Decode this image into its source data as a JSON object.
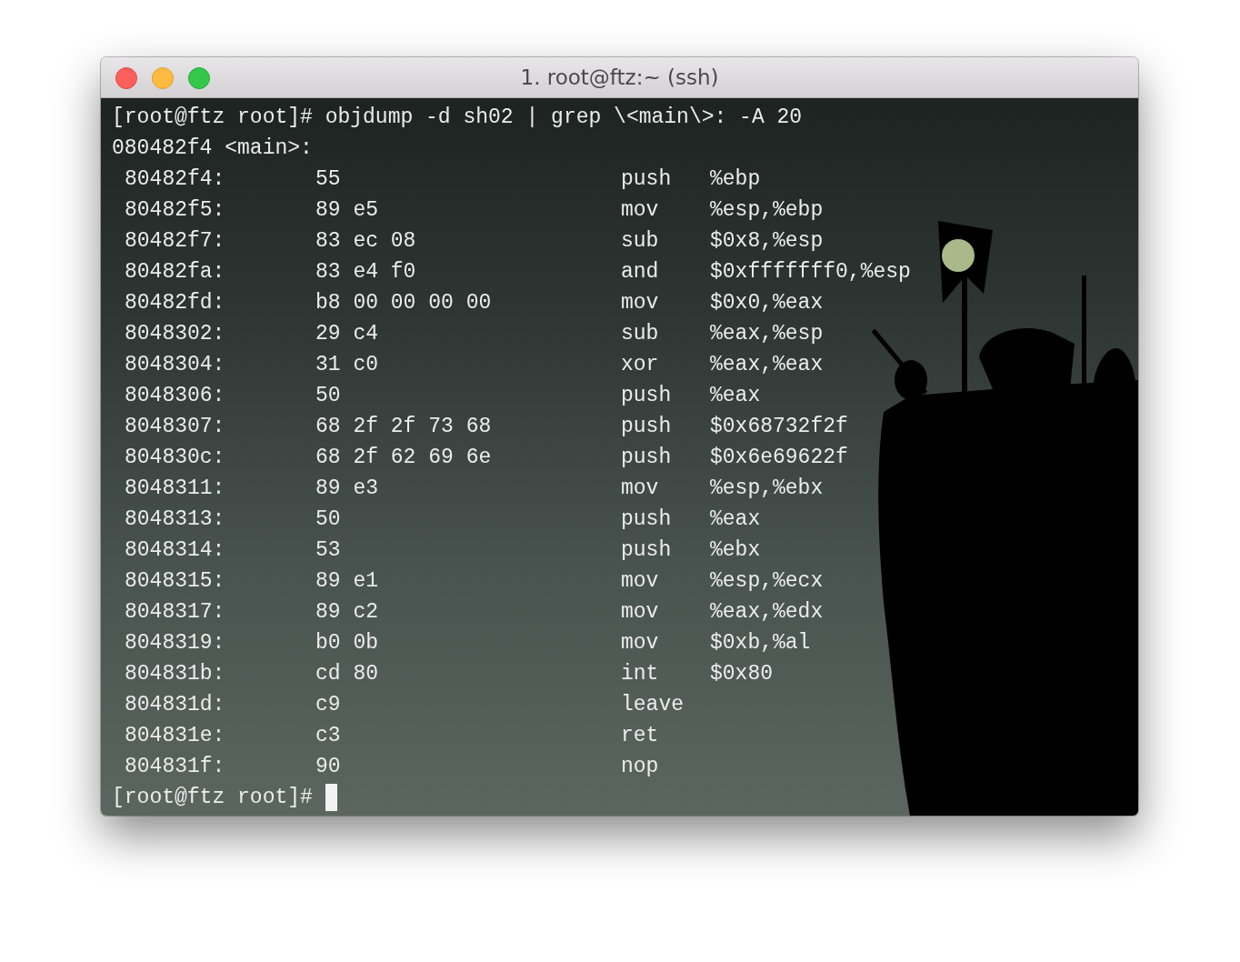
{
  "window": {
    "title": "1. root@ftz:~ (ssh)"
  },
  "terminal": {
    "prompt": "[root@ftz root]#",
    "command": "objdump -d sh02 | grep \\<main\\>: -A 20",
    "header": "080482f4 <main>:",
    "rows": [
      {
        "address": "80482f4:",
        "bytes": "55",
        "mnemonic": "push",
        "operands": "%ebp"
      },
      {
        "address": "80482f5:",
        "bytes": "89 e5",
        "mnemonic": "mov",
        "operands": "%esp,%ebp"
      },
      {
        "address": "80482f7:",
        "bytes": "83 ec 08",
        "mnemonic": "sub",
        "operands": "$0x8,%esp"
      },
      {
        "address": "80482fa:",
        "bytes": "83 e4 f0",
        "mnemonic": "and",
        "operands": "$0xfffffff0,%esp"
      },
      {
        "address": "80482fd:",
        "bytes": "b8 00 00 00 00",
        "mnemonic": "mov",
        "operands": "$0x0,%eax"
      },
      {
        "address": "8048302:",
        "bytes": "29 c4",
        "mnemonic": "sub",
        "operands": "%eax,%esp"
      },
      {
        "address": "8048304:",
        "bytes": "31 c0",
        "mnemonic": "xor",
        "operands": "%eax,%eax"
      },
      {
        "address": "8048306:",
        "bytes": "50",
        "mnemonic": "push",
        "operands": "%eax"
      },
      {
        "address": "8048307:",
        "bytes": "68 2f 2f 73 68",
        "mnemonic": "push",
        "operands": "$0x68732f2f"
      },
      {
        "address": "804830c:",
        "bytes": "68 2f 62 69 6e",
        "mnemonic": "push",
        "operands": "$0x6e69622f"
      },
      {
        "address": "8048311:",
        "bytes": "89 e3",
        "mnemonic": "mov",
        "operands": "%esp,%ebx"
      },
      {
        "address": "8048313:",
        "bytes": "50",
        "mnemonic": "push",
        "operands": "%eax"
      },
      {
        "address": "8048314:",
        "bytes": "53",
        "mnemonic": "push",
        "operands": "%ebx"
      },
      {
        "address": "8048315:",
        "bytes": "89 e1",
        "mnemonic": "mov",
        "operands": "%esp,%ecx"
      },
      {
        "address": "8048317:",
        "bytes": "89 c2",
        "mnemonic": "mov",
        "operands": "%eax,%edx"
      },
      {
        "address": "8048319:",
        "bytes": "b0 0b",
        "mnemonic": "mov",
        "operands": "$0xb,%al"
      },
      {
        "address": "804831b:",
        "bytes": "cd 80",
        "mnemonic": "int",
        "operands": "$0x80"
      },
      {
        "address": "804831d:",
        "bytes": "c9",
        "mnemonic": "leave"
      },
      {
        "address": "804831e:",
        "bytes": "c3",
        "mnemonic": "ret"
      },
      {
        "address": "804831f:",
        "bytes": "90",
        "mnemonic": "nop"
      }
    ],
    "final_prompt": "[root@ftz root]#"
  }
}
